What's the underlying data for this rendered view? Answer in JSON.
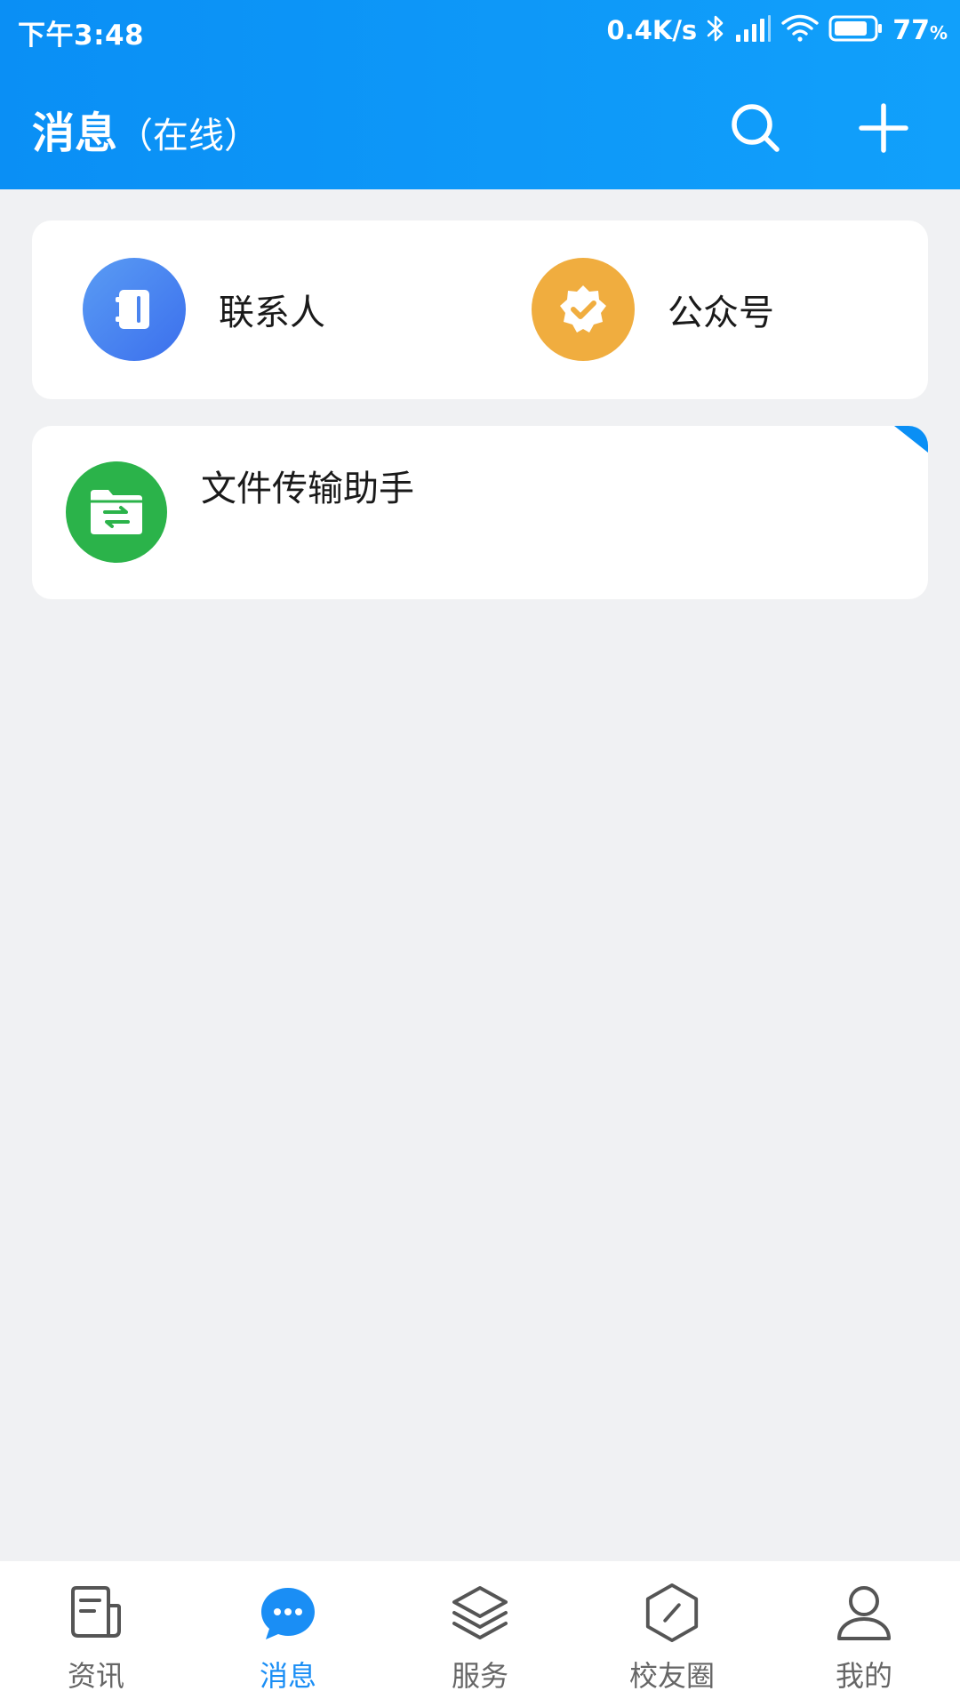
{
  "status_bar": {
    "time": "下午3:48",
    "net_speed": "0.4K/s",
    "battery_value": "77",
    "battery_unit": "%"
  },
  "app_bar": {
    "title": "消息",
    "subtitle": "（在线）",
    "search_icon": "search-icon",
    "add_icon": "plus-icon"
  },
  "quick_entries": [
    {
      "label": "联系人",
      "icon": "contacts-book-icon",
      "color": "#4f86f0"
    },
    {
      "label": "公众号",
      "icon": "verified-badge-icon",
      "color": "#f0ad3f"
    }
  ],
  "conversations": [
    {
      "name": "文件传输助手",
      "icon": "file-transfer-icon",
      "color": "#2bb34a",
      "pinned": true
    }
  ],
  "tabs": [
    {
      "label": "资讯",
      "icon": "news-icon",
      "active": false
    },
    {
      "label": "消息",
      "icon": "chat-bubble-icon",
      "active": true
    },
    {
      "label": "服务",
      "icon": "layers-icon",
      "active": false
    },
    {
      "label": "校友圈",
      "icon": "hexagon-slash-icon",
      "active": false
    },
    {
      "label": "我的",
      "icon": "user-icon",
      "active": false
    }
  ],
  "colors": {
    "primary": "#0a8ff5",
    "background": "#f0f1f3",
    "tab_active": "#1a8ef5",
    "tab_inactive": "#666666"
  }
}
